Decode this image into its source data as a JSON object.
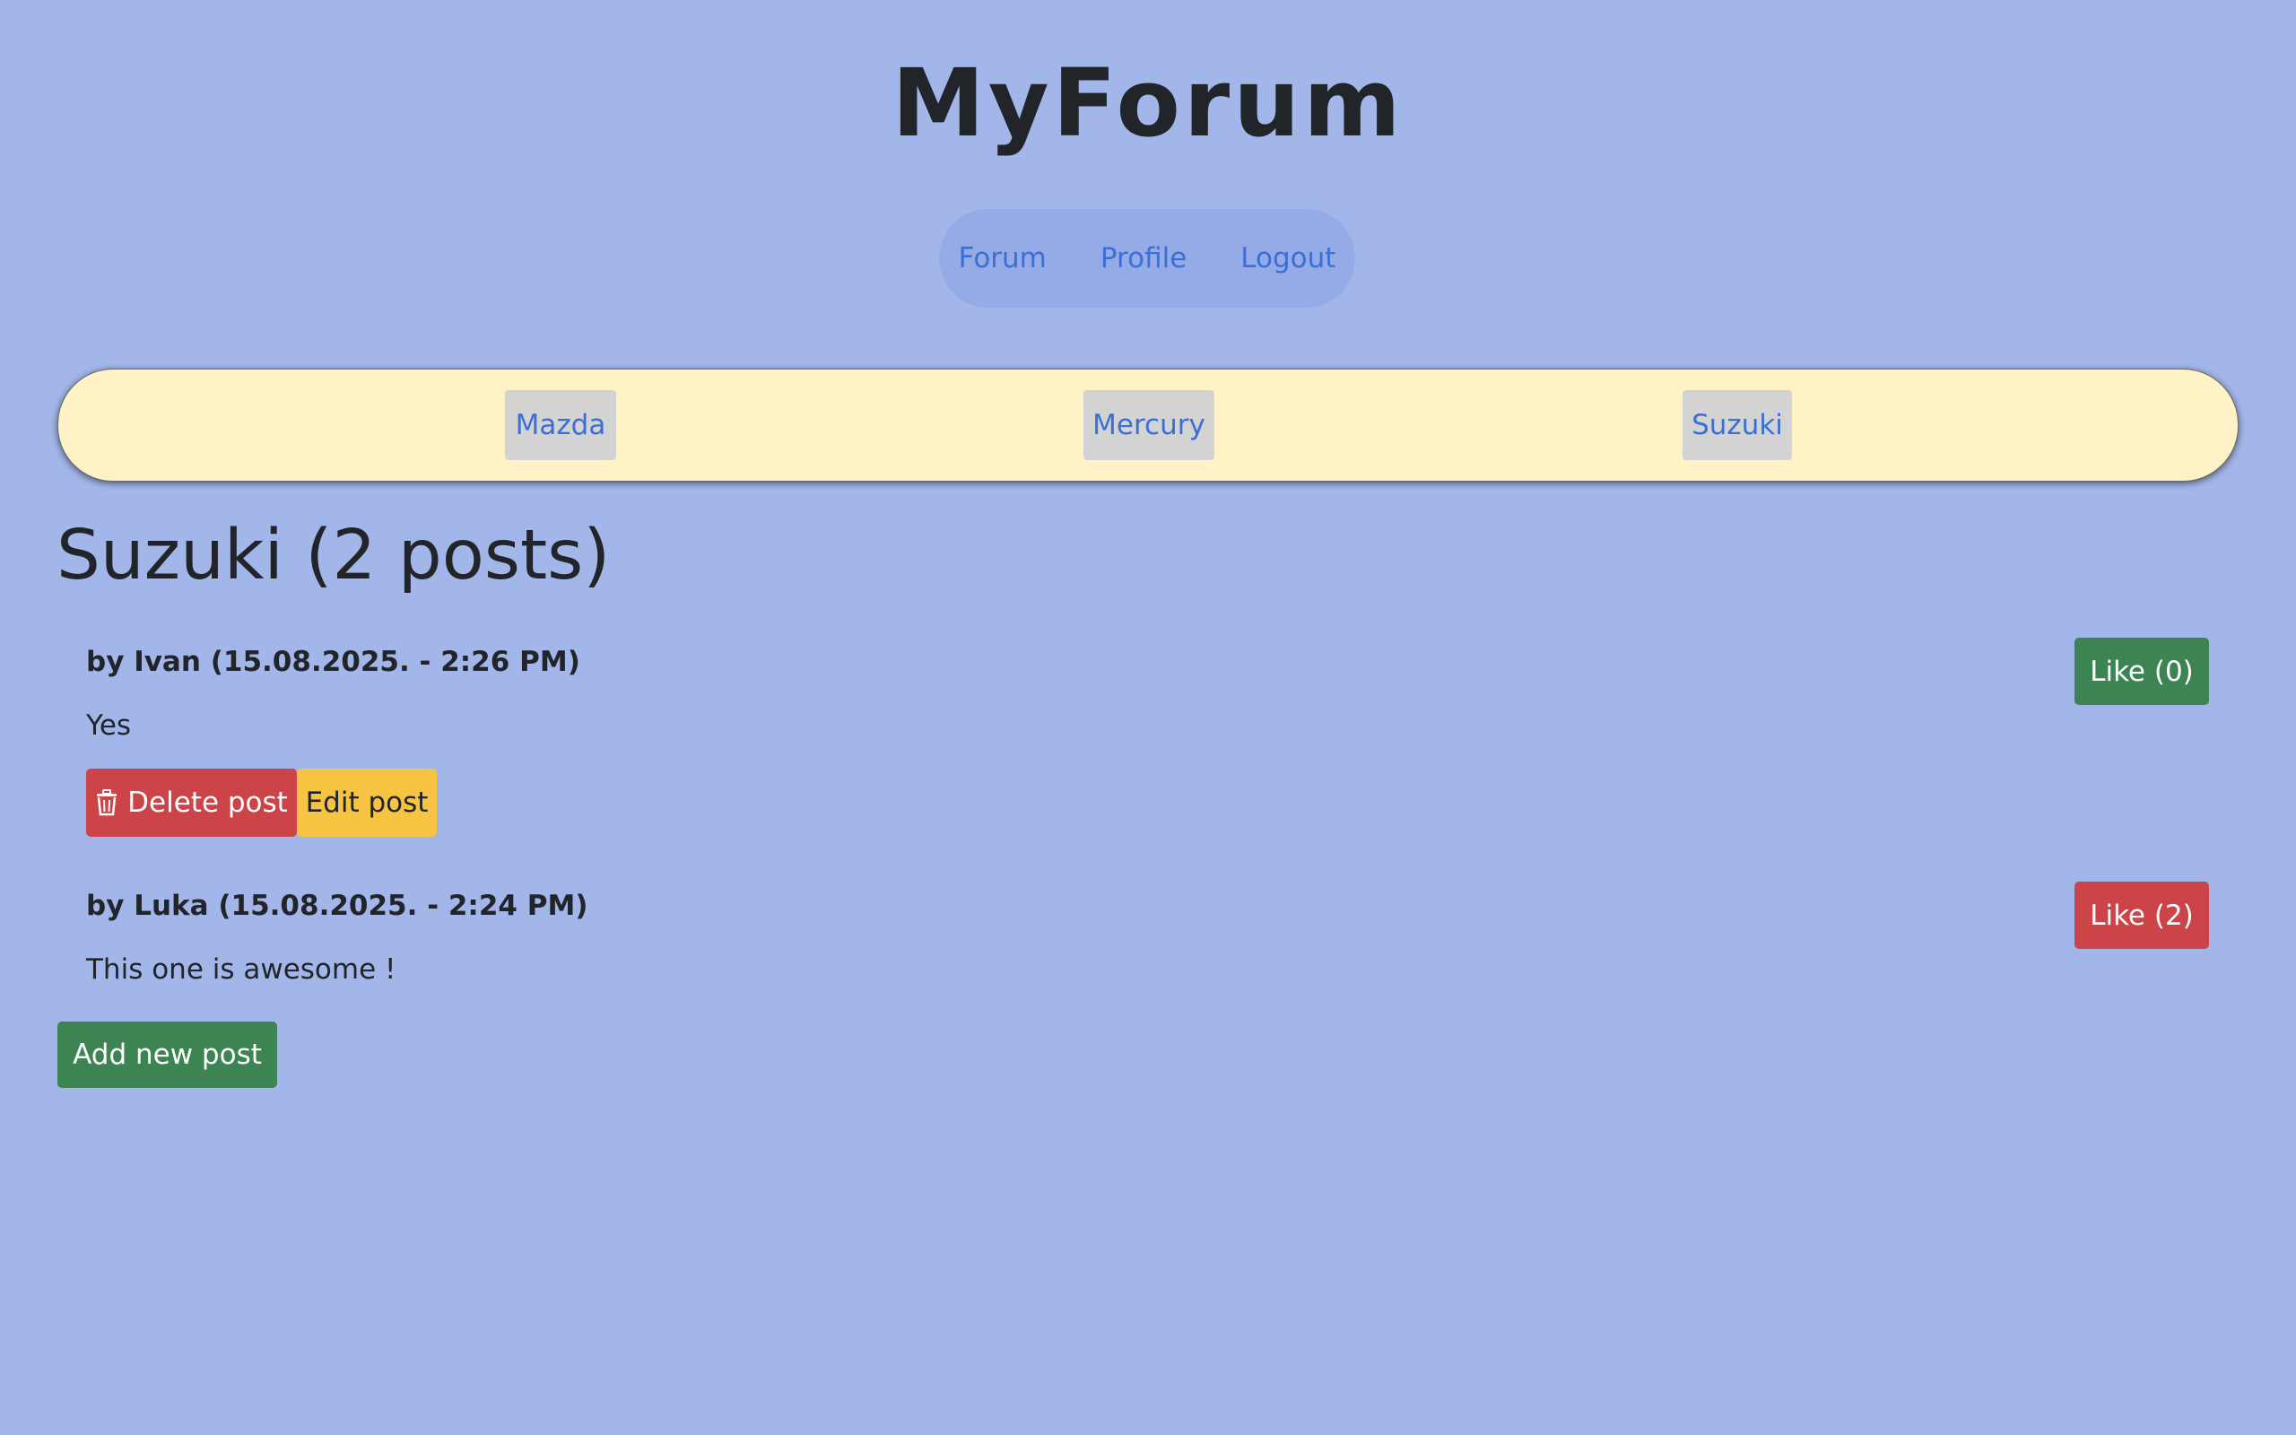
{
  "site": {
    "title": "MyForum"
  },
  "nav": {
    "items": [
      "Forum",
      "Profile",
      "Logout"
    ]
  },
  "brands": [
    "Mazda",
    "Mercury",
    "Suzuki"
  ],
  "page": {
    "heading": "Suzuki (2 posts)"
  },
  "posts": [
    {
      "meta": "by Ivan (15.08.2025. - 2:26 PM)",
      "body": "Yes",
      "like_label": "Like (0)",
      "like_color": "#3d8453",
      "delete_label": "Delete post",
      "edit_label": "Edit post"
    },
    {
      "meta": "by Luka (15.08.2025. - 2:24 PM)",
      "body": "This one is awesome !",
      "like_label": "Like (2)",
      "like_color": "#cc4448"
    }
  ],
  "actions": {
    "add_post_label": "Add new post"
  },
  "colors": {
    "background": "#a3b6e9",
    "link": "#3b6fd8",
    "brand_bar": "#fff2c6",
    "success": "#3d8453",
    "danger": "#cc4448",
    "warning": "#f6c342"
  },
  "icons": {
    "delete": "trash-icon"
  }
}
